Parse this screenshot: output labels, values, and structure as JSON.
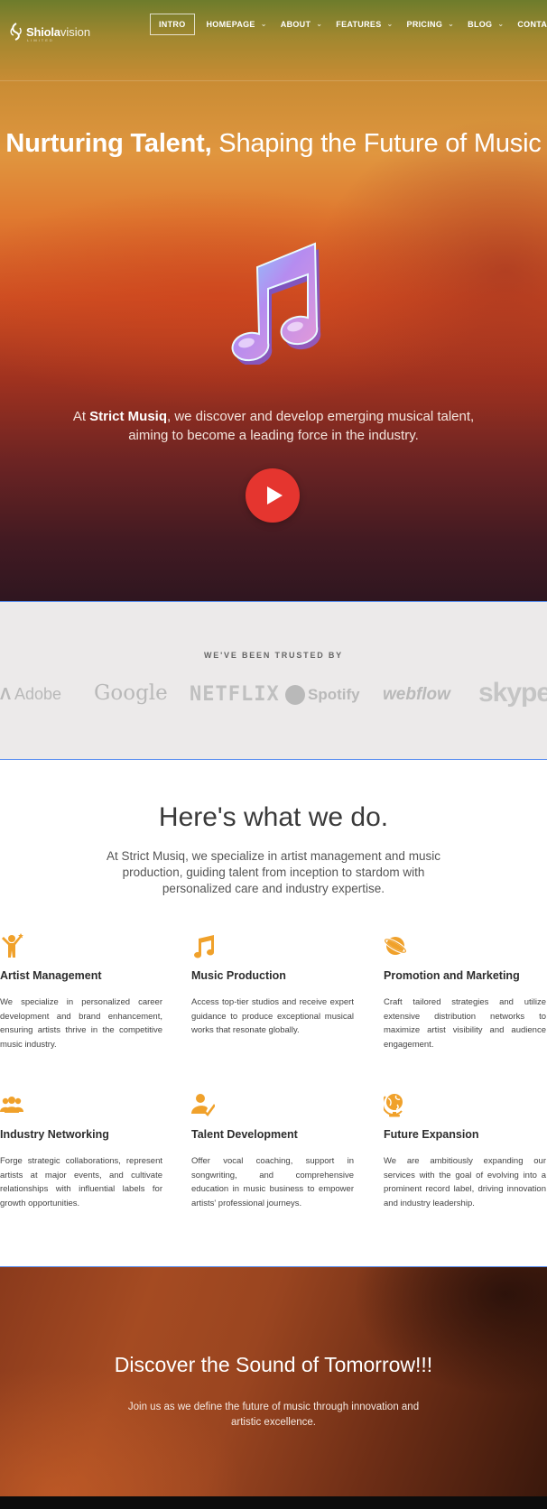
{
  "nav": {
    "logo_bold": "Shiola",
    "logo_light": "vision",
    "logo_sub": "LIMITED",
    "items": [
      {
        "label": "INTRO",
        "active": true
      },
      {
        "label": "HOMEPAGE"
      },
      {
        "label": "ABOUT"
      },
      {
        "label": "FEATURES"
      },
      {
        "label": "PRICING"
      },
      {
        "label": "BLOG"
      },
      {
        "label": "CONTACT"
      }
    ]
  },
  "hero": {
    "title_bold": "Nurturing Talent,",
    "title_rest": " Shaping the Future of Music",
    "desc_prefix": "At ",
    "desc_brand": "Strict Musiq",
    "desc_rest": ", we discover and develop emerging musical talent, aiming to become a leading force in the industry.",
    "image_icon": "music-note-icon",
    "play_icon": "play-icon"
  },
  "trusted": {
    "title": "WE'VE BEEN TRUSTED BY",
    "brands": [
      "Adobe",
      "Google",
      "NETFLIX",
      "Spotify",
      "webflow",
      "skype"
    ]
  },
  "services": {
    "title": "Here's what we do.",
    "intro": "At Strict Musiq, we specialize in artist management and music production, guiding talent from inception to stardom with personalized care and industry expertise.",
    "accent": "#f0a12b",
    "items": [
      {
        "title": "Artist Management",
        "icon": "person-star-icon",
        "desc": "We specialize in personalized career development and brand enhancement, ensuring artists thrive in the competitive music industry."
      },
      {
        "title": "Music Production",
        "icon": "music-notes-icon",
        "desc": "Access top-tier studios and receive expert guidance to produce exceptional musical works that resonate globally."
      },
      {
        "title": "Promotion and Marketing",
        "icon": "planet-icon",
        "desc": "Craft tailored strategies and utilize extensive distribution networks to maximize artist visibility and audience engagement."
      },
      {
        "title": "Industry Networking",
        "icon": "group-icon",
        "desc": "Forge strategic collaborations, represent artists at major events, and cultivate relationships with influential labels for growth opportunities."
      },
      {
        "title": "Talent Development",
        "icon": "user-check-icon",
        "desc": "Offer vocal coaching, support in songwriting, and comprehensive education in music business to empower artists' professional journeys."
      },
      {
        "title": "Future Expansion",
        "icon": "globe-icon",
        "desc": "We are ambitiously expanding our services with the goal of evolving into a prominent record label, driving innovation and industry leadership."
      }
    ]
  },
  "cta": {
    "title": "Discover the Sound of Tomorrow!!!",
    "text": "Join us as we define the future of music through innovation and artistic excellence."
  }
}
